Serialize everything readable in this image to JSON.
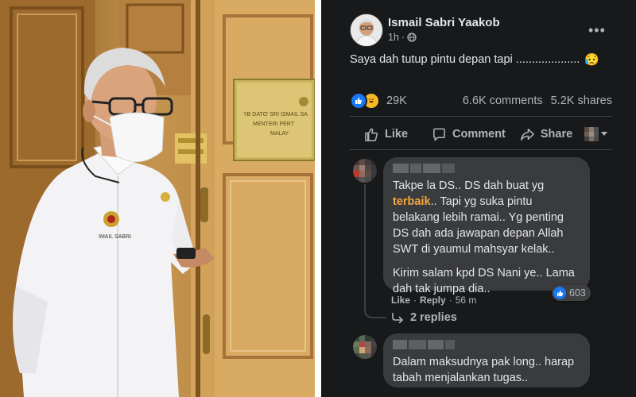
{
  "photo": {
    "badge_text": "IMAIL SABRI",
    "plaque_line1": "YB DATO' SRI ISMAIL SA",
    "plaque_line2": "MENTERI PERT",
    "plaque_line3": "MALAY"
  },
  "post": {
    "author": "Ismail Sabri Yaakob",
    "time": "1h",
    "audience_separator": "·",
    "text": "Saya dah tutup pintu depan tapi ....................",
    "emoji": "😥",
    "reactions_count": "29K",
    "comments_count": "6.6K comments",
    "shares_count": "5.2K shares",
    "more_icon_text": "•••"
  },
  "actions": {
    "like": "Like",
    "comment": "Comment",
    "share": "Share"
  },
  "comments": [
    {
      "para1_a": "Takpe la DS.. DS dah buat yg ",
      "para1_hl": "terbaik",
      "para1_b": ".. Tapi yg suka pintu belakang lebih ramai.. Yg penting DS dah ada jawapan depan Allah SWT di yaumul mahsyar kelak..",
      "para2": "Kirim salam kpd DS Nani ye.. Lama dah tak jumpa dia..",
      "like": "Like",
      "reply": "Reply",
      "time": "56 m",
      "separator": "·",
      "reactions": "603"
    },
    {
      "text": "Dalam maksudnya pak long.. harap tabah menjalankan tugas.."
    }
  ],
  "replies_label": "2 replies",
  "colors": {
    "accent": "#1877f2",
    "highlight": "#f7a840",
    "bg": "#18191a",
    "bubble": "#3a3b3c"
  }
}
